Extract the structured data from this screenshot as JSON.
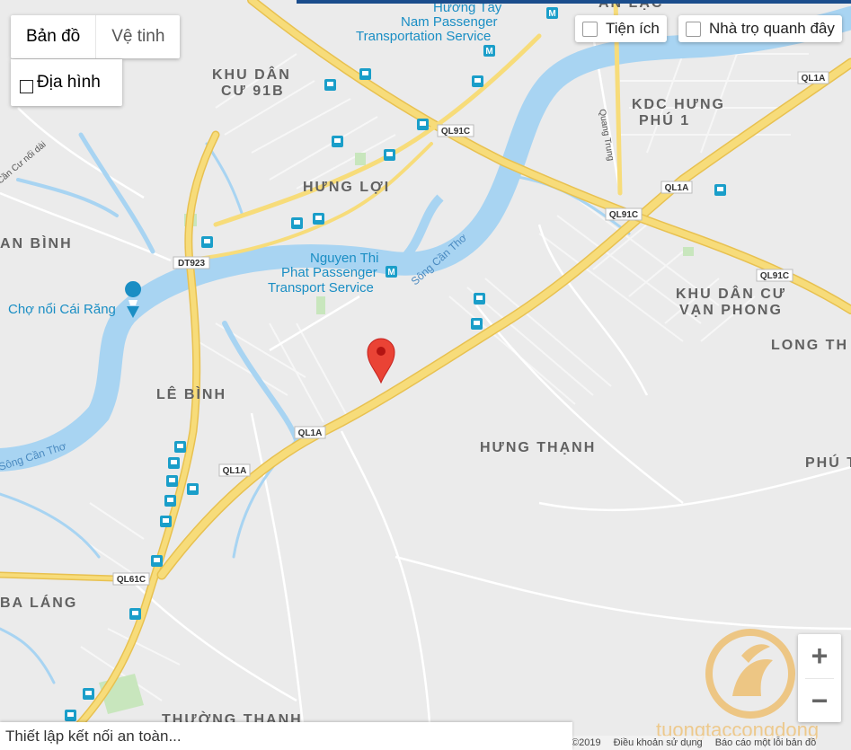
{
  "map_type": {
    "map_label": "Bản đồ",
    "satellite_label": "Vệ tinh",
    "terrain_label": "Địa hình"
  },
  "overlays": {
    "amenities_label": "Tiện ích",
    "rooms_label": "Nhà trọ quanh đây"
  },
  "status_text": "Thiết lập kết nối an toàn...",
  "footer": {
    "copyright": "©2019",
    "terms": "Điều khoản sử dụng",
    "report": "Báo cáo một lỗi bản đồ"
  },
  "watermark_text": "tuongtaccongdong",
  "zoom": {
    "in": "+",
    "out": "−"
  },
  "colors": {
    "land": "#ebebeb",
    "water": "#a8d4f2",
    "highway": "#f7dc7a",
    "highway_edge": "#e8c150",
    "marker": "#ea4335",
    "transit": "#1a9ec9"
  },
  "places": [
    {
      "text": "KHU DÂN"
    },
    {
      "text": "CƯ 91B"
    },
    {
      "text": "HƯNG LỢI"
    },
    {
      "text": "KDC HƯNG"
    },
    {
      "text": "PHÚ 1"
    },
    {
      "text": "KHU DÂN CƯ"
    },
    {
      "text": "VẠN PHONG"
    },
    {
      "text": "LONG TH"
    },
    {
      "text": "AN BÌNH"
    },
    {
      "text": "LÊ BÌNH"
    },
    {
      "text": "HƯNG THẠNH"
    },
    {
      "text": "PHÚ T"
    },
    {
      "text": "BA LÁNG"
    },
    {
      "text": "THƯỜNG THẠNH"
    },
    {
      "text": "AN LẠC"
    }
  ],
  "pois": [
    {
      "text": "Hướng Tây"
    },
    {
      "text": "Nam Passenger"
    },
    {
      "text": "Transportation Service"
    },
    {
      "text": "Nguyen Thi"
    },
    {
      "text": "Phat Passenger"
    },
    {
      "text": "Transport Service"
    },
    {
      "text": "Chợ nổi Cái Răng"
    }
  ],
  "rivers": [
    {
      "text": "Sông Cần Thơ"
    },
    {
      "text": "Sông Cần Thơ"
    },
    {
      "text": "Quang Trung"
    },
    {
      "text": "Cần Cư nối dài"
    }
  ],
  "shields": [
    {
      "text": "QL91C"
    },
    {
      "text": "QL1A"
    },
    {
      "text": "QL91C"
    },
    {
      "text": "DT923"
    },
    {
      "text": "QL91C"
    },
    {
      "text": "QL1A"
    },
    {
      "text": "QL1A"
    },
    {
      "text": "QL1A"
    },
    {
      "text": "QL61C"
    }
  ]
}
